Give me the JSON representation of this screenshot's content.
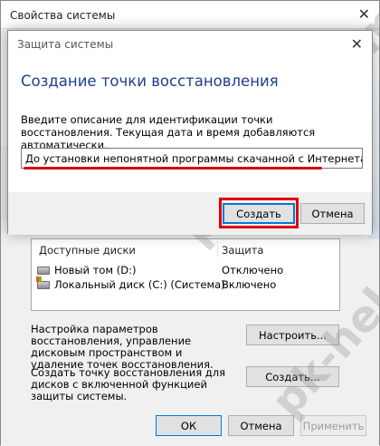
{
  "background_window": {
    "title": "Свойства системы",
    "close_glyph": "✕",
    "drives_table": {
      "headers": [
        "Доступные диски",
        "Защита"
      ],
      "rows": [
        {
          "name": "Новый том (D:)",
          "protection": "Отключено"
        },
        {
          "name": "Локальный диск (C:) (Система)",
          "protection": "Включено"
        }
      ]
    },
    "configure_desc": "Настройка параметров восстановления, управление дисковым пространством и удаление точек восстановления.",
    "configure_button": "Настроить...",
    "create_desc": "Создать точку восстановления для дисков с включенной функцией защиты системы.",
    "create_button": "Создать...",
    "ok_button": "ОК",
    "cancel_button": "Отмена",
    "apply_button": "Применить"
  },
  "dialog": {
    "title": "Защита системы",
    "close_glyph": "✕",
    "heading": "Создание точки восстановления",
    "description": "Введите описание для идентификации точки восстановления. Текущая дата и время добавляются автоматически.",
    "input_value": "До установки непонятной программы скачанной с Интернета.",
    "create_button": "Создать",
    "cancel_button": "Отмена"
  },
  "watermark": {
    "top": "pk-help.com",
    "bottom": "pk-help.com"
  },
  "colors": {
    "highlight_red": "#e00000",
    "heading_blue": "#1e3f8a",
    "focus_blue": "#0078d7"
  }
}
